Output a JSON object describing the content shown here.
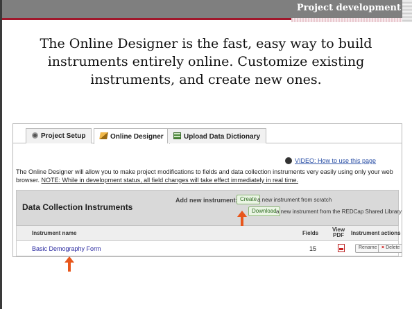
{
  "slide": {
    "section_title": "Project development",
    "headline": "The Online Designer is the fast, easy way to build instruments entirely online. Customize existing instruments, and create new ones."
  },
  "tabs": [
    {
      "label": "Project Setup",
      "icon": "gear-icon"
    },
    {
      "label": "Online Designer",
      "icon": "pencil-icon"
    },
    {
      "label": "Upload Data Dictionary",
      "icon": "table-icon"
    }
  ],
  "video_link": {
    "label": "VIDEO: How to use this page",
    "icon": "video-icon"
  },
  "intro": {
    "text": "The Online Designer will allow you to make project modifications to fields and data collection instruments very easily using only your web browser.",
    "note": "NOTE: While in development status, all field changes will take effect immediately in real time."
  },
  "panel": {
    "title": "Data Collection Instruments",
    "add_label": "Add new instrument:",
    "create_button": "Create",
    "create_text": "a new instrument from scratch",
    "download_button": "Download",
    "download_text": "a new instrument from the REDCap Shared Library"
  },
  "table": {
    "headers": {
      "name": "Instrument name",
      "fields": "Fields",
      "view_pdf": "View PDF",
      "actions": "Instrument actions"
    },
    "rows": [
      {
        "name": "Basic Demography Form",
        "fields": "15",
        "rename": "Rename",
        "delete": "Delete"
      }
    ]
  },
  "colors": {
    "accent": "#a0172b",
    "arrow": "#e8561b",
    "link": "#2a4fa6"
  }
}
